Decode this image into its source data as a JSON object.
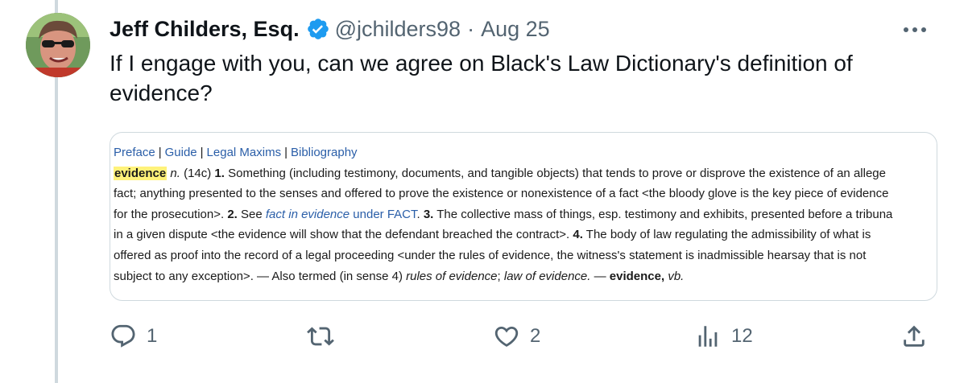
{
  "tweet": {
    "author_name": "Jeff Childers, Esq.",
    "handle": "@jchilders98",
    "separator": "·",
    "date": "Aug 25",
    "text": "If I engage with you, can we agree on Black's Law Dictionary's definition of evidence?"
  },
  "dictionary": {
    "nav": [
      "Preface",
      "Guide",
      "Legal Maxims",
      "Bibliography"
    ],
    "nav_separator": "|",
    "headword": "evidence",
    "line1": {
      "pos": "n.",
      "rest_a": " (14c) ",
      "num1": "1.",
      "rest_b": " Something (including testimony, documents, and tangible objects) that tends to prove or disprove the existence of an allege"
    },
    "line2": "fact; anything presented to the senses and offered to prove the existence or nonexistence of a fact <the bloody glove is the key piece of evidence",
    "line3": {
      "a": "for the prosecution>. ",
      "num2": "2.",
      "b": " See ",
      "ref_italic": "fact in evidence",
      "ref_plain": " under FACT",
      "c": ". ",
      "num3": "3.",
      "d": " The collective mass of things, esp. testimony and exhibits, presented before a tribuna"
    },
    "line4": {
      "a": "in a given dispute <the evidence will show that the defendant breached the contract>. ",
      "num4": "4.",
      "b": " The body of law regulating the admissibility of what is"
    },
    "line5": "offered as proof into the record of a legal proceeding <under the rules of evidence, the witness's statement is inadmissible hearsay that is not",
    "line6": {
      "a": "subject to any exception>. — Also termed (in sense 4) ",
      "i1": "rules of evidence",
      "b": "; ",
      "i2": "law of evidence.",
      "c": " — ",
      "bold": "evidence,",
      "d": " ",
      "i3": "vb."
    }
  },
  "actions": {
    "reply_count": "1",
    "retweet_count": "",
    "like_count": "2",
    "views_count": "12"
  },
  "icons": [
    "verified-badge-icon",
    "more-icon",
    "reply-icon",
    "retweet-icon",
    "like-icon",
    "views-icon",
    "share-icon"
  ],
  "colors": {
    "verified": "#1d9bf0",
    "secondary_text": "#536471",
    "link": "#2a5ea8",
    "highlight": "#fff27a"
  }
}
